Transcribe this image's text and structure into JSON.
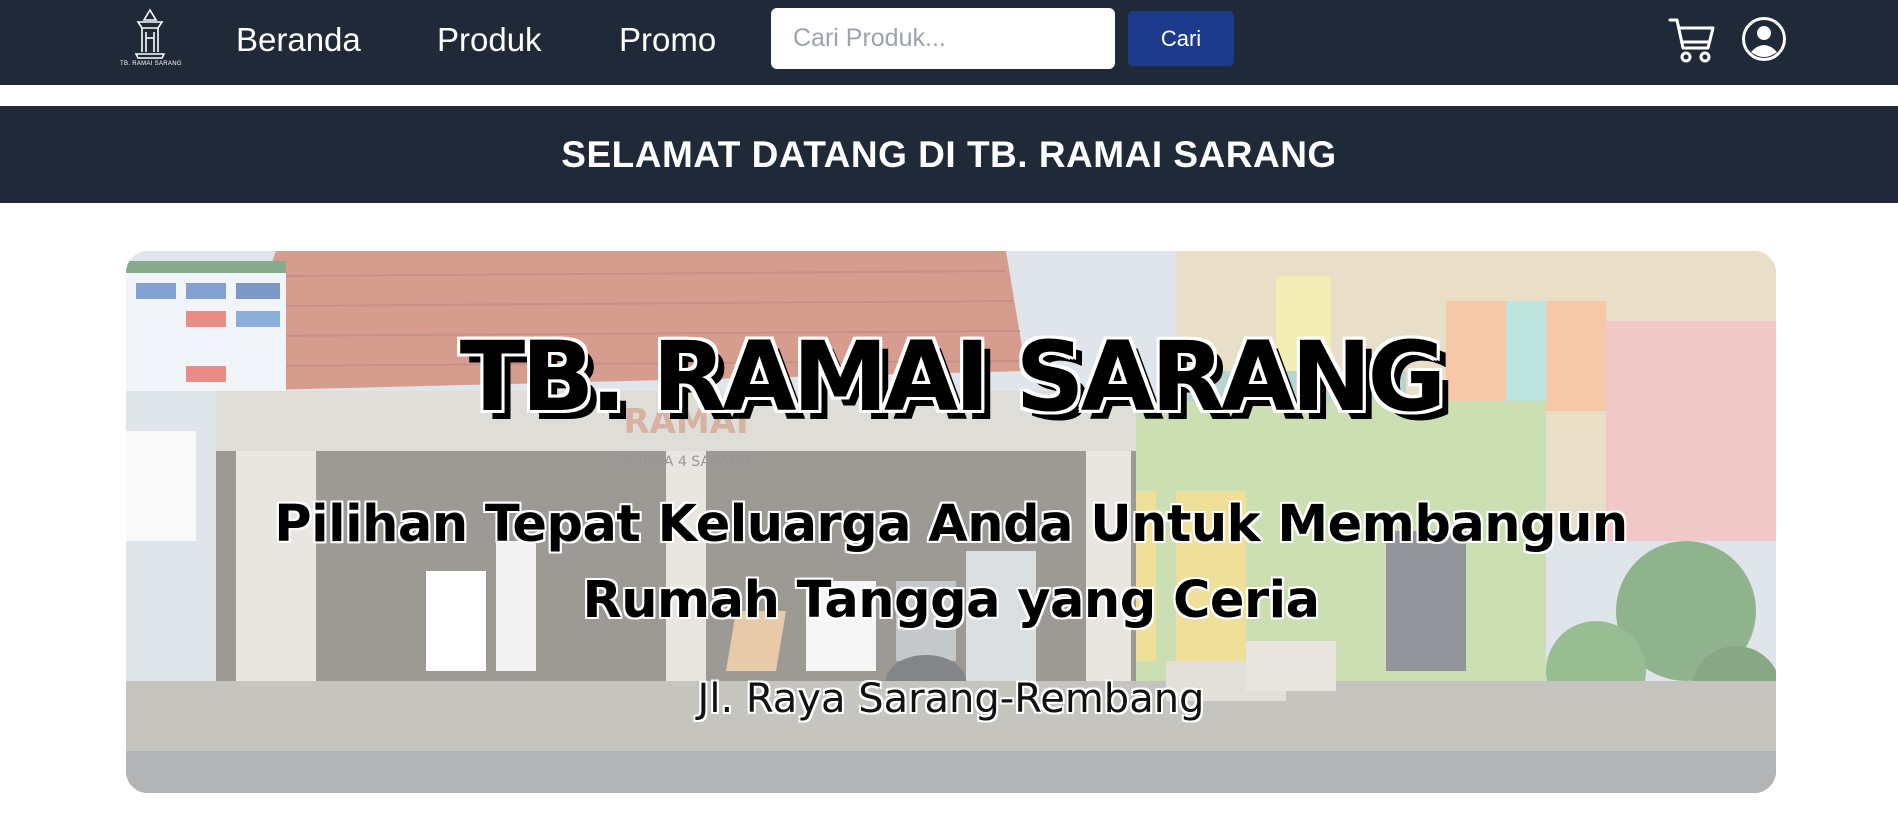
{
  "brand": {
    "logo_text": "TB. RAMAI SARANG"
  },
  "nav": {
    "links": [
      "Beranda",
      "Produk",
      "Promo"
    ],
    "search_placeholder": "Cari Produk...",
    "search_button": "Cari",
    "icons": [
      "cart-icon",
      "user-icon"
    ]
  },
  "welcome": {
    "text": "SELAMAT DATANG DI TB. RAMAI SARANG"
  },
  "hero": {
    "title": "TB. RAMAI SARANG",
    "tagline_line1": "Pilihan Tepat Keluarga Anda Untuk Membangun",
    "tagline_line2": "Rumah Tangga yang Ceria",
    "address": "Jl. Raya Sarang-Rembang",
    "photo_sign_text": "RAMAI",
    "photo_sign_subtext": "Jl. RAYA 4 SARANG"
  },
  "colors": {
    "navbar": "#1f2937",
    "button": "#1e3a8a",
    "text_light": "#ffffff"
  }
}
